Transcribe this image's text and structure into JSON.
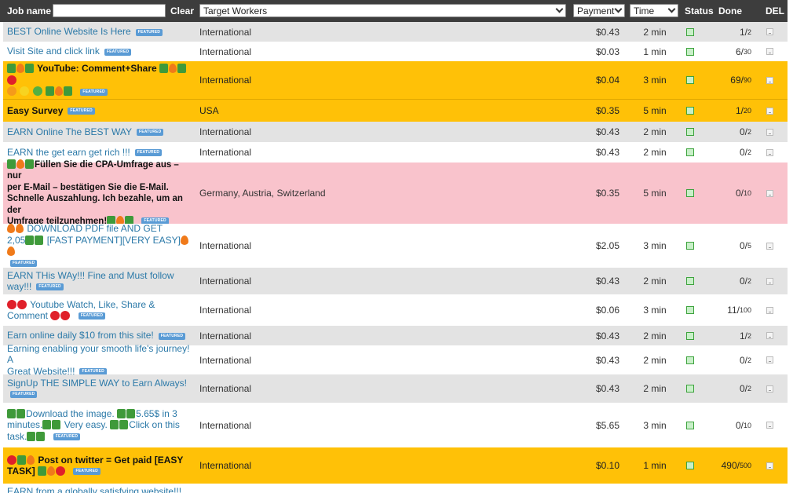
{
  "header": {
    "job_name_label": "Job name",
    "job_name_value": "",
    "clear_label": "Clear",
    "target_select": "Target Workers",
    "payment_select": "Payment",
    "time_select": "Time",
    "status_label": "Status",
    "done_label": "Done",
    "del_label": "DEL"
  },
  "badge_text": "FEATURED",
  "colors": {
    "gray": "#e3e3e3",
    "white": "#ffffff",
    "yellow": "#ffc107",
    "pink": "#f9c3cc",
    "link": "#2b79a8",
    "header": "#3d3d3d"
  },
  "rows": [
    {
      "name": "BEST Online Website Is Here",
      "country": "International",
      "payment": "$0.43",
      "time": "2 min",
      "done": "1",
      "total": "2"
    },
    {
      "name": "Visit Site and click link",
      "country": "International",
      "payment": "$0.03",
      "time": "1 min",
      "done": "6",
      "total": "30"
    },
    {
      "name_a": "YouTube: Comment+Share",
      "country": "International",
      "payment": "$0.04",
      "time": "3 min",
      "done": "69",
      "total": "90"
    },
    {
      "name": "Easy Survey",
      "country": "USA",
      "payment": "$0.35",
      "time": "5 min",
      "done": "1",
      "total": "20"
    },
    {
      "name": "EARN Online The BEST WAY",
      "country": "International",
      "payment": "$0.43",
      "time": "2 min",
      "done": "0",
      "total": "2"
    },
    {
      "name": "EARN the get earn get rich !!!",
      "country": "International",
      "payment": "$0.43",
      "time": "2 min",
      "done": "0",
      "total": "2"
    },
    {
      "name_l1": "Füllen Sie die CPA-Umfrage aus – nur",
      "name_l2": "per E-Mail – bestätigen Sie die E-Mail.",
      "name_l3": "Schnelle Auszahlung. Ich bezahle, um an der",
      "name_l4": "Umfrage teilzunehmen!",
      "country": "Germany, Austria, Switzerland",
      "payment": "$0.35",
      "time": "5 min",
      "done": "0",
      "total": "10"
    },
    {
      "name_l1": "DOWNLOAD PDF file AND GET",
      "name_l2a": "2,05",
      "name_l2b": "[FAST PAYMENT][VERY EASY]",
      "country": "International",
      "payment": "$2.05",
      "time": "3 min",
      "done": "0",
      "total": "5"
    },
    {
      "name_l1": "EARN THis WAy!!! Fine and Must follow",
      "name_l2": "way!!!",
      "country": "International",
      "payment": "$0.43",
      "time": "2 min",
      "done": "0",
      "total": "2"
    },
    {
      "name_l1": "Youtube Watch, Like, Share &",
      "name_l2": "Comment",
      "country": "International",
      "payment": "$0.06",
      "time": "3 min",
      "done": "11",
      "total": "100"
    },
    {
      "name": "Earn online daily $10 from this site!",
      "country": "International",
      "payment": "$0.43",
      "time": "2 min",
      "done": "1",
      "total": "2"
    },
    {
      "name_l1": "Earning enabling your smooth life's journey! A",
      "name_l2": "Great Website!!!",
      "country": "International",
      "payment": "$0.43",
      "time": "2 min",
      "done": "0",
      "total": "2"
    },
    {
      "name": "SignUp THE SIMPLE WAY to Earn Always!",
      "country": "International",
      "payment": "$0.43",
      "time": "2 min",
      "done": "0",
      "total": "2"
    },
    {
      "name_l1a": "Download the image.",
      "name_l1b": "5.65$ in 3",
      "name_l2a": "minutes.",
      "name_l2b": "Very easy.",
      "name_l2c": "Click on this",
      "name_l3": "task.",
      "country": "International",
      "payment": "$5.65",
      "time": "3 min",
      "done": "0",
      "total": "10"
    },
    {
      "name_l1": "Post on twitter = Get paid [EASY",
      "name_l2": "TASK]",
      "country": "International",
      "payment": "$0.10",
      "time": "1 min",
      "done": "490",
      "total": "500"
    },
    {
      "name": "EARN from a globally satisfying website!!!"
    }
  ]
}
